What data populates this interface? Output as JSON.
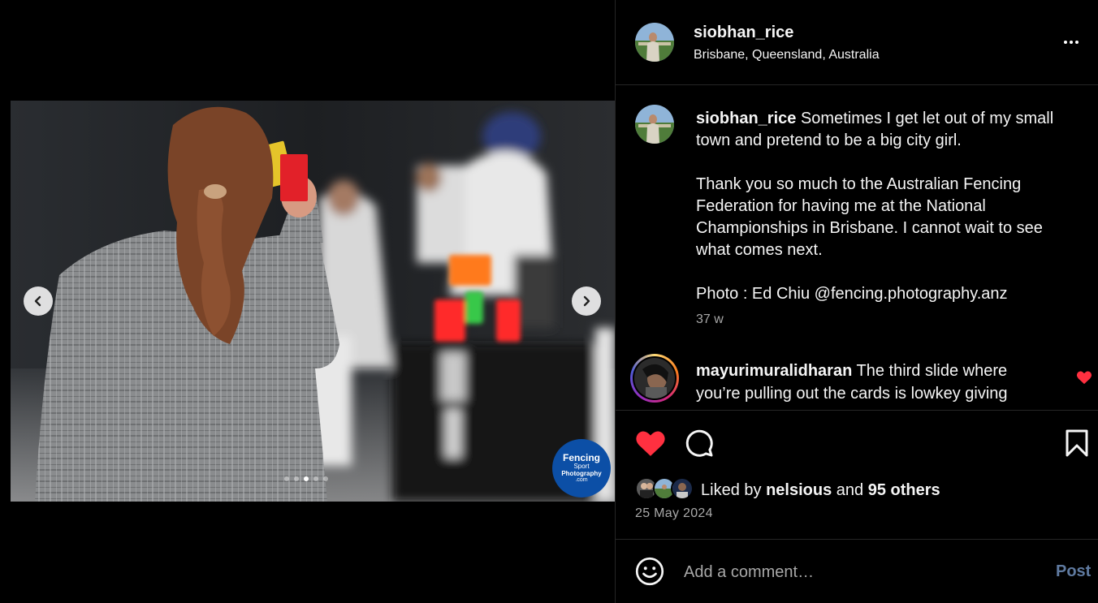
{
  "post": {
    "username": "siobhan_rice",
    "location": "Brisbane, Queensland, Australia"
  },
  "media": {
    "watermark_lines": [
      "Fencing",
      "Sport",
      "Photography",
      ".com"
    ],
    "carousel_count": 5,
    "active_index": 2
  },
  "caption": {
    "username": "siobhan_rice",
    "paragraphs": [
      "Sometimes I get let out of my small town and pretend to be a big city girl.",
      "Thank you so much to the Australian Fencing Federation for having me at the National Championships in Brisbane. I cannot wait to see what comes next.",
      "Photo : Ed Chiu @fencing.photography.anz"
    ],
    "time_ago": "37 w"
  },
  "comment": {
    "username": "mayurimuralidharan",
    "text": "The third slide where you’re pulling out the cards is lowkey giving",
    "liked_color": "#ff3040"
  },
  "likes": {
    "prefix": "Liked by",
    "first_user": "nelsious",
    "joiner": "and",
    "others": "95 others"
  },
  "date": "25 May 2024",
  "composer": {
    "placeholder": "Add a comment…",
    "post_label": "Post"
  },
  "colors": {
    "like_red": "#ff3040",
    "post_button": "#5f7aa0",
    "secondary_text": "#a8a8a8",
    "divider": "#262626"
  }
}
